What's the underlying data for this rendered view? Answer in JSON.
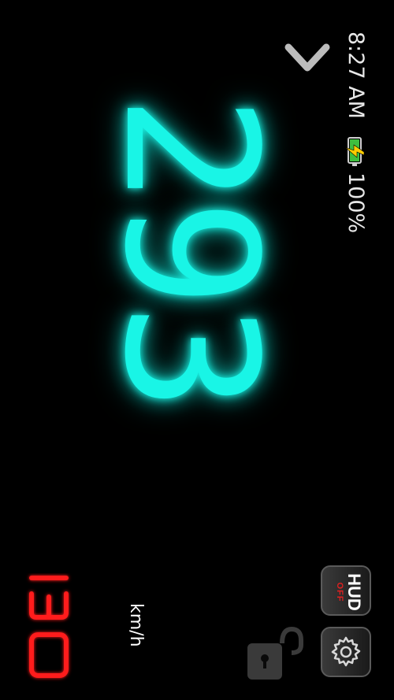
{
  "status_bar": {
    "time": "8:27 AM",
    "battery_percent": "100%",
    "battery_icon": "battery-charging-icon"
  },
  "navigation": {
    "back_icon": "chevron-down-icon"
  },
  "speedometer": {
    "speed": "293",
    "unit": "km/h",
    "speed_color": "#19f5e6"
  },
  "speed_limit": {
    "value": "130",
    "color": "#ff1a1a"
  },
  "controls": {
    "hud_label": "HUD",
    "hud_state": "OFF",
    "settings_icon": "gear-icon",
    "lock_icon": "unlocked-padlock-icon"
  }
}
